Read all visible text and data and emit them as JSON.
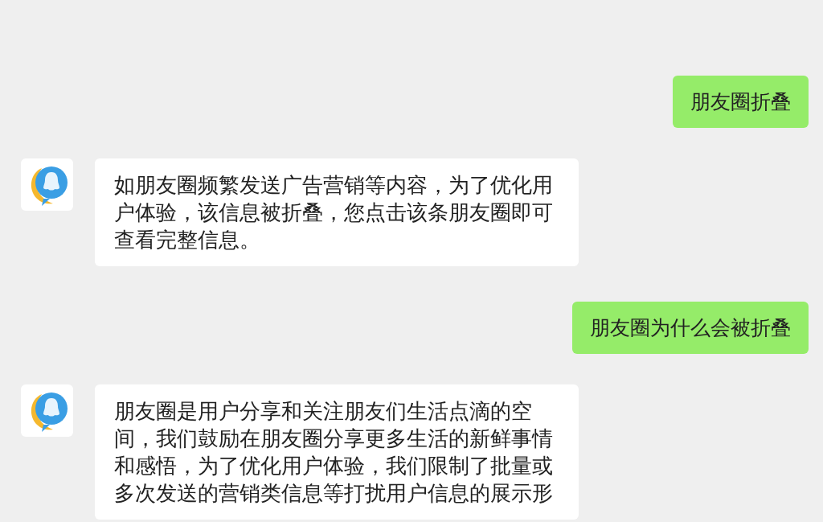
{
  "messages": [
    {
      "kind": "sent",
      "text": "朋友圈折叠"
    },
    {
      "kind": "received",
      "text": "如朋友圈频繁发送广告营销等内容，为了优化用户体验，该信息被折叠，您点击该条朋友圈即可查看完整信息。"
    },
    {
      "kind": "sent",
      "text": "朋友圈为什么会被折叠"
    },
    {
      "kind": "received",
      "text": "朋友圈是用户分享和关注朋友们生活点滴的空间，我们鼓励在朋友圈分享更多生活的新鲜事情和感悟，为了优化用户体验，我们限制了批量或多次发送的营销类信息等打扰用户信息的展示形"
    }
  ]
}
